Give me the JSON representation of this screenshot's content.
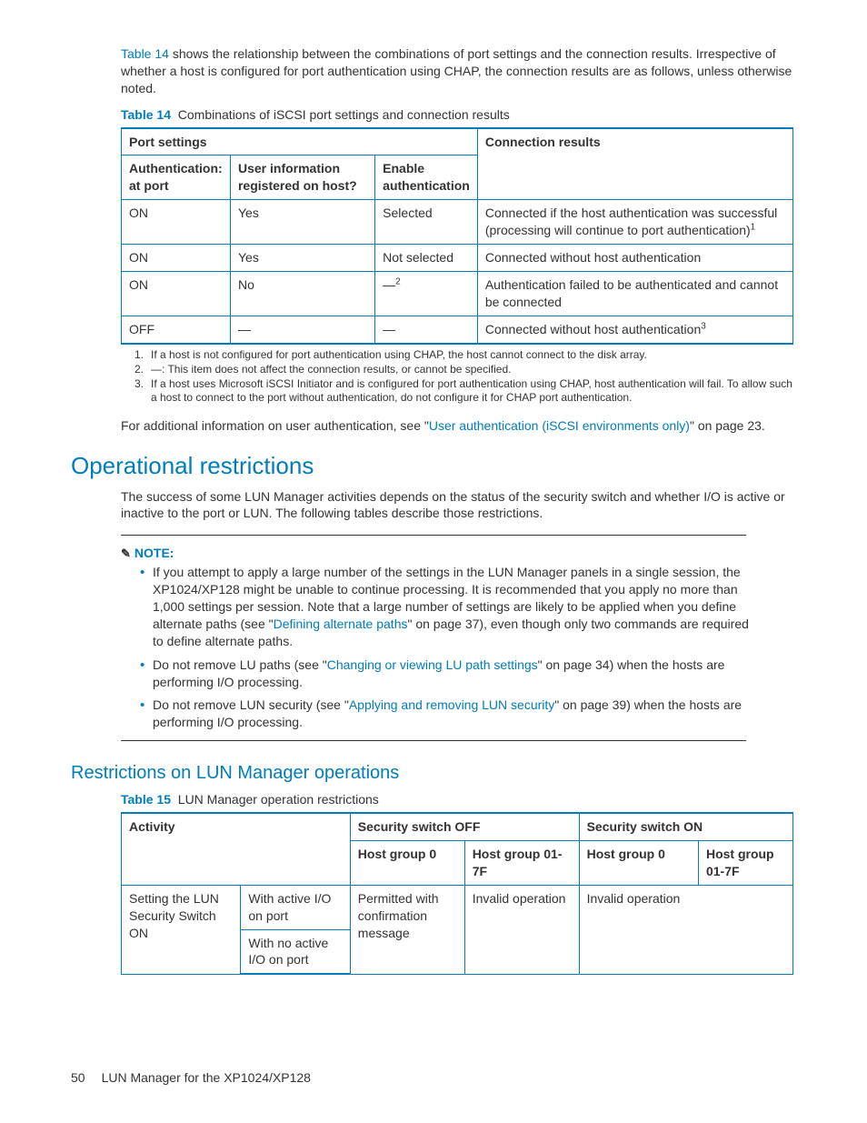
{
  "intro": {
    "ref": "Table 14",
    "text_after_ref": " shows the relationship between the combinations of port settings and the connection results. Irrespective of whether a host is configured for port authentication using CHAP, the connection results are as follows, unless otherwise noted."
  },
  "table14": {
    "label": "Table 14",
    "caption": "Combinations of iSCSI port settings and connection results",
    "headers": {
      "port_settings": "Port settings",
      "connection_results": "Connection results",
      "auth_at_port": "Authentication: at port",
      "user_info": "User information registered on host?",
      "enable_auth": "Enable authentication"
    },
    "rows": [
      {
        "auth": "ON",
        "user": "Yes",
        "enable": "Selected",
        "result": "Connected if the host authentication was successful (processing will continue to port authentication)",
        "result_sup": "1"
      },
      {
        "auth": "ON",
        "user": "Yes",
        "enable": "Not selected",
        "result": "Connected without host authentication",
        "result_sup": ""
      },
      {
        "auth": "ON",
        "user": "No",
        "enable": "—",
        "enable_sup": "2",
        "result": "Authentication failed to be authenticated and cannot be connected",
        "result_sup": ""
      },
      {
        "auth": "OFF",
        "user": "—",
        "enable": "—",
        "result": "Connected without host authentication",
        "result_sup": "3"
      }
    ],
    "footnotes": [
      {
        "n": "1.",
        "t": "If a host is not configured for port authentication using CHAP, the host cannot connect to the disk array."
      },
      {
        "n": "2.",
        "t": "—: This item does not affect the connection results, or cannot be specified."
      },
      {
        "n": "3.",
        "t": "If a host uses Microsoft iSCSI Initiator and is configured for port authentication using CHAP, host authentication will fail. To allow such a host to connect to the port without authentication, do not configure it for CHAP port authentication."
      }
    ]
  },
  "additional_info": {
    "pre": "For additional information on user authentication, see \"",
    "link": "User authentication (iSCSI environments only)",
    "post": "\" on page 23."
  },
  "section_op": {
    "title": "Operational restrictions",
    "para": "The success of some LUN Manager activities depends on the status of the security switch and whether I/O is active or inactive to the port or LUN. The following tables describe those restrictions."
  },
  "note": {
    "label": "NOTE:",
    "items": [
      {
        "pre": "If you attempt to apply a large number of the settings in the LUN Manager panels in a single session, the XP1024/XP128 might be unable to continue processing. It is recommended that you apply no more than 1,000 settings per session. Note that a large number of settings are likely to be applied when you define alternate paths (see \"",
        "link": "Defining alternate paths",
        "post": "\" on page 37), even though only two commands are required to define alternate paths."
      },
      {
        "pre": "Do not remove LU paths (see \"",
        "link": "Changing or viewing LU path settings",
        "post": "\" on page 34) when the hosts are performing I/O processing."
      },
      {
        "pre": "Do not remove LUN security (see \"",
        "link": "Applying and removing LUN security",
        "post": "\" on page 39) when the hosts are performing I/O processing."
      }
    ]
  },
  "subsection": {
    "title": "Restrictions on LUN Manager operations"
  },
  "table15": {
    "label": "Table 15",
    "caption": "LUN Manager operation restrictions",
    "headers": {
      "activity": "Activity",
      "sec_off": "Security switch OFF",
      "sec_on": "Security switch ON",
      "hg0": "Host group 0",
      "hg01": "Host group 01-7F"
    },
    "row": {
      "activity": "Setting the LUN Security Switch ON",
      "cond_active": "With active I/O on port",
      "cond_noactive": "With no active I/O on port",
      "off_hg0": "Permitted with confirmation message",
      "off_hg01": "Invalid operation",
      "on_hg0": "Invalid operation"
    }
  },
  "footer": {
    "page": "50",
    "doc": "LUN Manager for the XP1024/XP128"
  }
}
